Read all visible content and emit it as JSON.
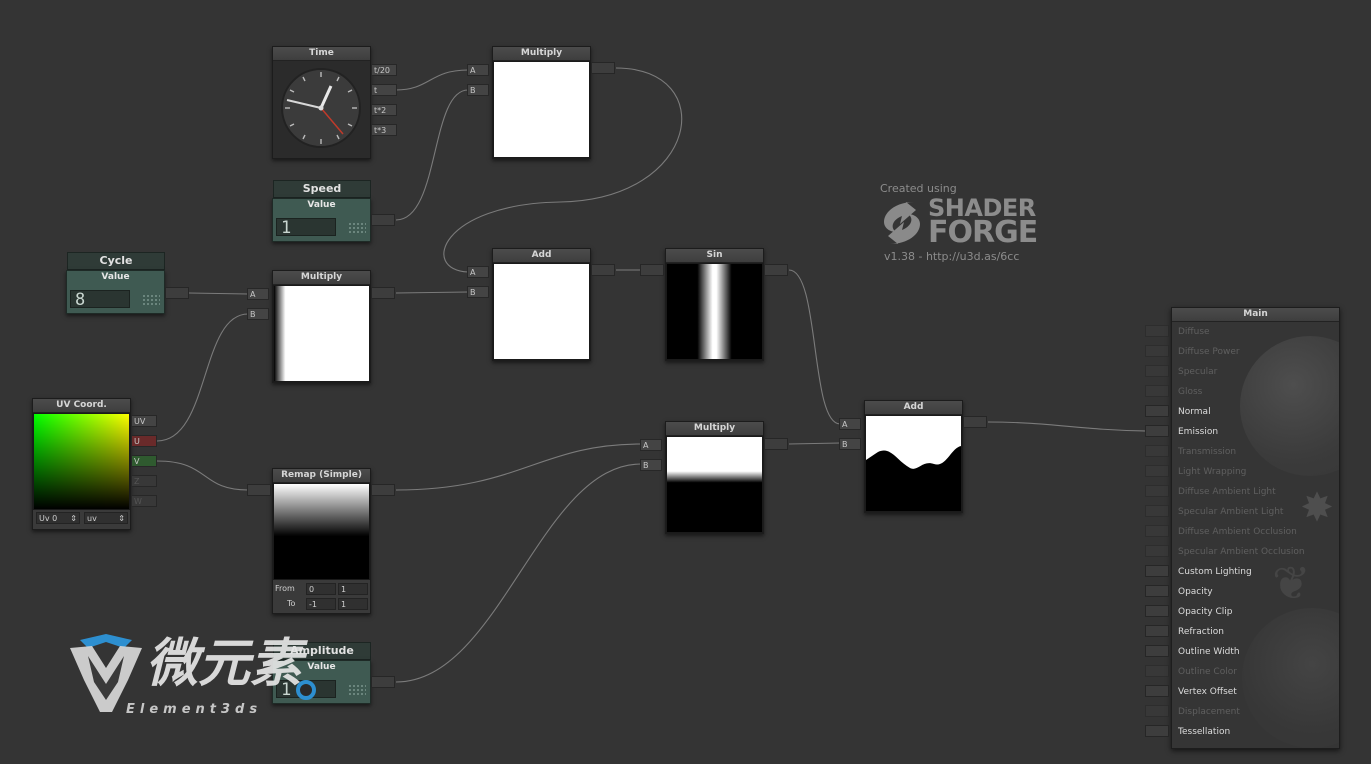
{
  "watermark": {
    "created_using": "Created using",
    "brand_line1": "SHADER",
    "brand_line2": "FORGE",
    "version": "v1.38 - http://u3d.as/6cc",
    "logo_text": "微元素",
    "logo_sub": "Element3ds"
  },
  "nodes": {
    "time": {
      "title": "Time",
      "outputs": [
        "t/20",
        "t",
        "t*2",
        "t*3"
      ]
    },
    "speed": {
      "header": "Speed",
      "sub": "Value",
      "value": "1"
    },
    "cycle": {
      "header": "Cycle",
      "sub": "Value",
      "value": "8"
    },
    "amplitude": {
      "header": "Amplitude",
      "sub": "Value",
      "value": "1"
    },
    "multiply_top": {
      "title": "Multiply",
      "inputs": [
        "A",
        "B"
      ]
    },
    "multiply_mid": {
      "title": "Multiply",
      "inputs": [
        "A",
        "B"
      ]
    },
    "multiply_low": {
      "title": "Multiply",
      "inputs": [
        "A",
        "B"
      ]
    },
    "add_top": {
      "title": "Add",
      "inputs": [
        "A",
        "B"
      ]
    },
    "add_right": {
      "title": "Add",
      "inputs": [
        "A",
        "B"
      ]
    },
    "sin": {
      "title": "Sin"
    },
    "uv": {
      "title": "UV Coord.",
      "outputs": [
        "UV",
        "U",
        "V",
        "Z",
        "W"
      ],
      "channel_select": "Uv 0",
      "mode_select": "uv"
    },
    "remap": {
      "title": "Remap (Simple)",
      "from_label": "From",
      "to_label": "To",
      "from_min": "0",
      "from_max": "1",
      "to_min": "-1",
      "to_max": "1"
    }
  },
  "main_panel": {
    "title": "Main",
    "inputs": [
      {
        "label": "Diffuse",
        "active": false
      },
      {
        "label": "Diffuse Power",
        "active": false
      },
      {
        "label": "Specular",
        "active": false
      },
      {
        "label": "Gloss",
        "active": false
      },
      {
        "label": "Normal",
        "active": true
      },
      {
        "label": "Emission",
        "active": true
      },
      {
        "label": "Transmission",
        "active": false
      },
      {
        "label": "Light Wrapping",
        "active": false
      },
      {
        "label": "Diffuse Ambient Light",
        "active": false
      },
      {
        "label": "Specular Ambient Light",
        "active": false
      },
      {
        "label": "Diffuse Ambient Occlusion",
        "active": false
      },
      {
        "label": "Specular Ambient Occlusion",
        "active": false
      },
      {
        "label": "Custom Lighting",
        "active": true
      },
      {
        "label": "Opacity",
        "active": true
      },
      {
        "label": "Opacity Clip",
        "active": true
      },
      {
        "label": "Refraction",
        "active": true
      },
      {
        "label": "Outline Width",
        "active": true
      },
      {
        "label": "Outline Color",
        "active": false
      },
      {
        "label": "Vertex Offset",
        "active": true
      },
      {
        "label": "Displacement",
        "active": false
      },
      {
        "label": "Tessellation",
        "active": true
      }
    ]
  },
  "colors": {
    "background": "#343434",
    "value_node": "#3f5a52",
    "wire": "#7a7a7a",
    "u_port": "#6a2a2a",
    "v_port": "#2f5a2f"
  }
}
